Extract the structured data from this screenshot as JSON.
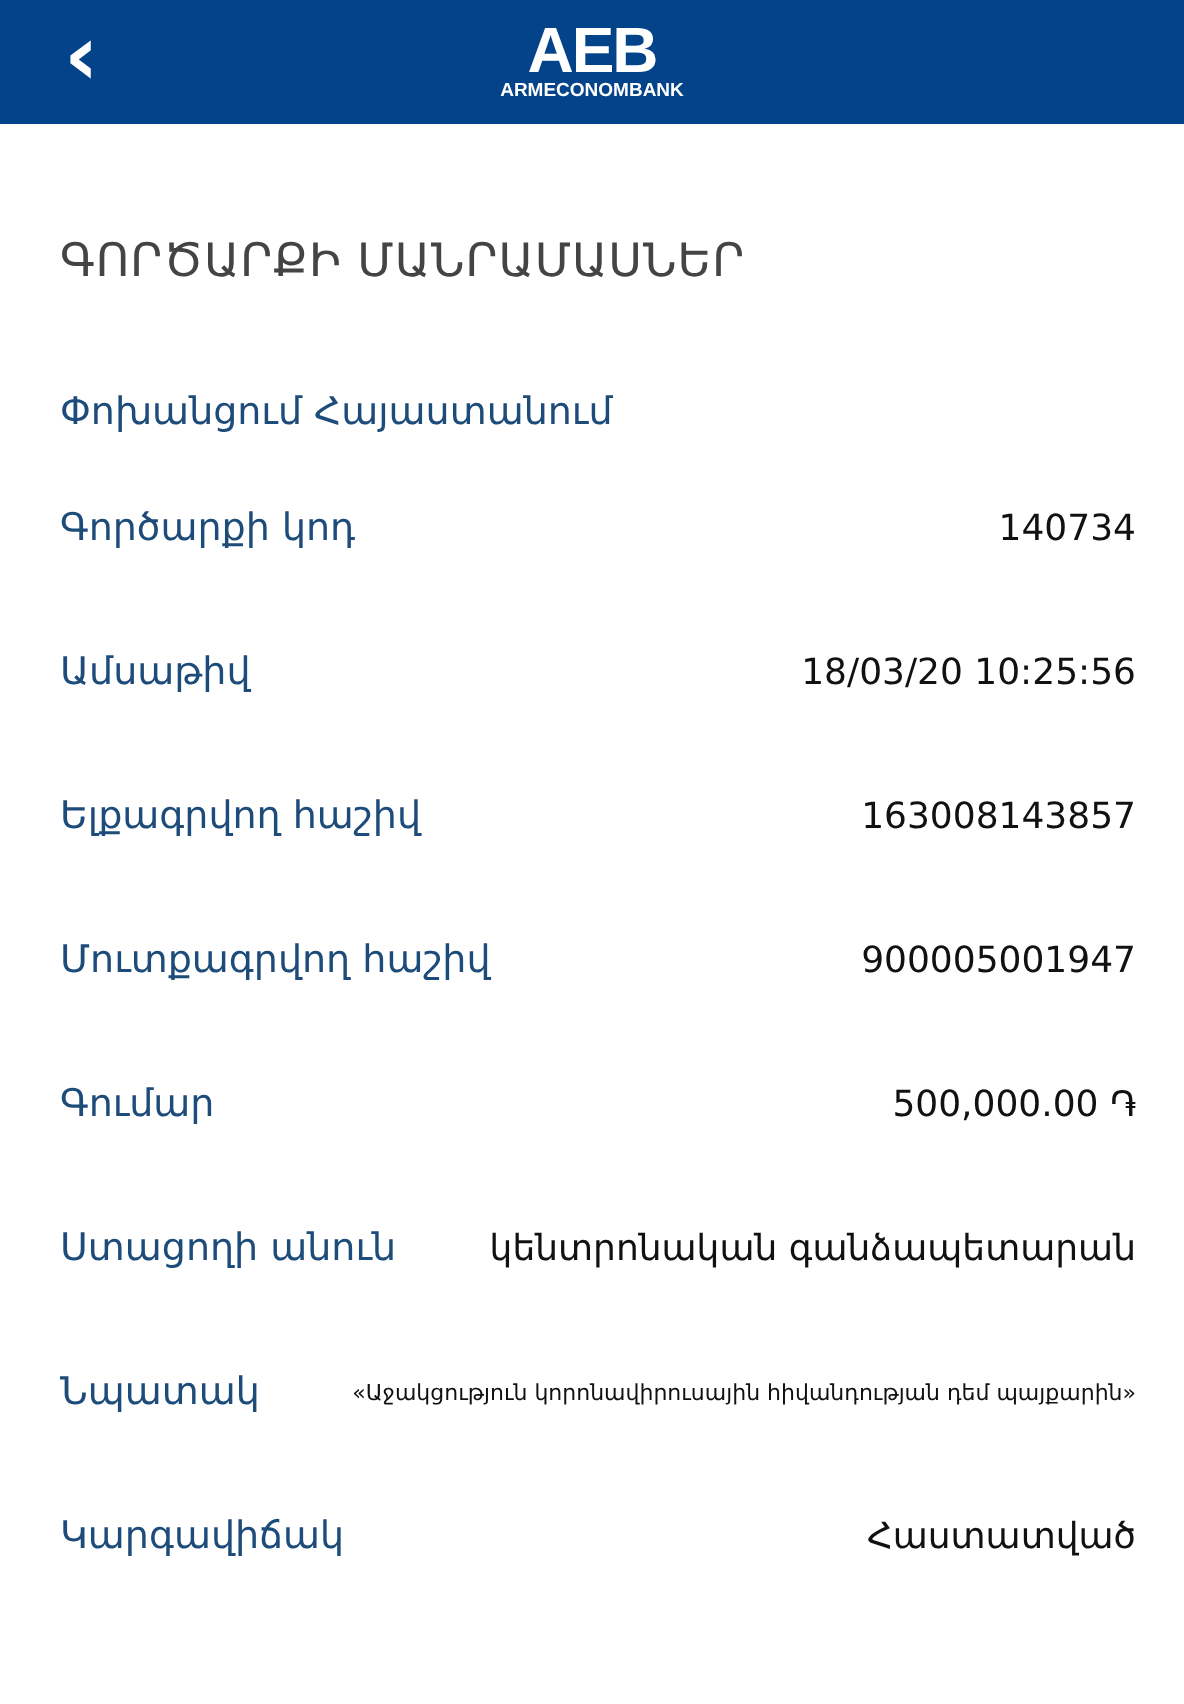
{
  "header": {
    "back": "‹",
    "logo": "AEB",
    "logo_caption": "ARMECONOMBANK"
  },
  "title": "ԳՈՐԾԱՐՔԻ ՄԱՆՐԱՄԱՍՆԵՐ",
  "subtitle": "Փոխանցում Հայաստանում",
  "details": [
    {
      "label": "Գործարքի կոդ",
      "value": "140734",
      "kind": "normal"
    },
    {
      "label": "Ամսաթիվ",
      "value": "18/03/20 10:25:56",
      "kind": "normal"
    },
    {
      "label": "Ելքագրվող հաշիվ",
      "value": "163008143857",
      "kind": "normal"
    },
    {
      "label": "Մուտքագրվող հաշիվ",
      "value": "900005001947",
      "kind": "normal"
    },
    {
      "label": "Գումար",
      "value": "500,000.00 ֏",
      "kind": "normal"
    },
    {
      "label": "Ստացողի անուն",
      "value": "կենտրոնական գանձապետարան",
      "kind": "normal"
    },
    {
      "label": "Նպատակ",
      "value": "«Աջակցություն կորոնավիրուսային հիվանդության դեմ պայքարին»",
      "kind": "small"
    },
    {
      "label": "Կարգավիճակ",
      "value": "Հաստատված",
      "kind": "normal"
    }
  ]
}
